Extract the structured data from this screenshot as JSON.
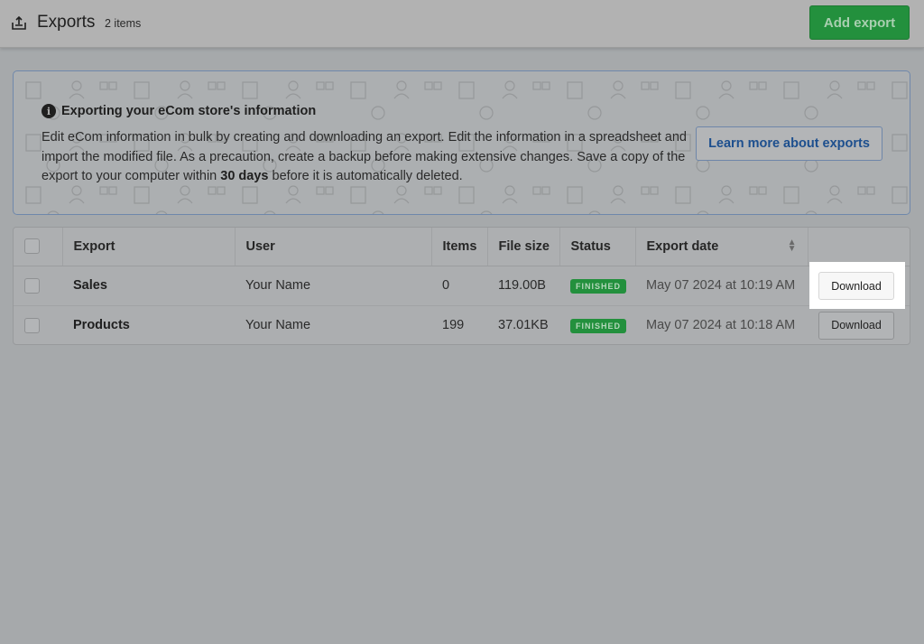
{
  "header": {
    "icon": "export-tray-icon",
    "title": "Exports",
    "count": "2 items",
    "add_button": "Add export"
  },
  "info_box": {
    "icon": "info-icon",
    "title": "Exporting your eCom store's information",
    "text_before": "Edit eCom information in bulk by creating and downloading an export. Edit the information in a spreadsheet and import the modified file. As a precaution, create a backup before making extensive changes. Save a copy of the export to your computer within ",
    "text_bold": "30 days",
    "text_after": " before it is automatically deleted.",
    "learn_button": "Learn more about exports"
  },
  "table": {
    "columns": [
      "Export",
      "User",
      "Items",
      "File size",
      "Status",
      "Export date"
    ],
    "rows": [
      {
        "export": "Sales",
        "user": "Your Name",
        "items": "0",
        "file_size": "119.00B",
        "status": "FINISHED",
        "date": "May 07 2024 at 10:19 AM",
        "action": "Download"
      },
      {
        "export": "Products",
        "user": "Your Name",
        "items": "199",
        "file_size": "37.01KB",
        "status": "FINISHED",
        "date": "May 07 2024 at 10:18 AM",
        "action": "Download"
      }
    ]
  },
  "colors": {
    "primary_green": "#23903d",
    "link_blue": "#1d4f8e",
    "overlay_gray": "#a6a9ab"
  }
}
